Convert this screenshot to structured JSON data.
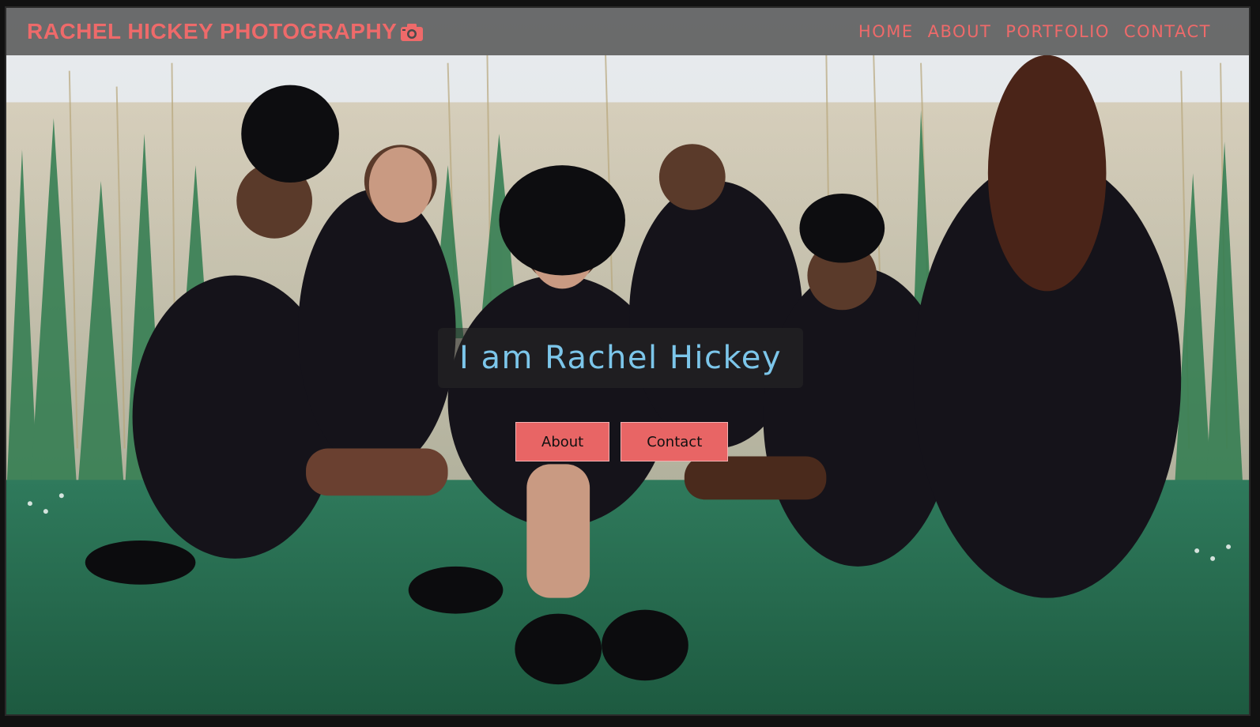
{
  "header": {
    "brand": "RACHEL HICKEY PHOTOGRAPHY",
    "brand_icon": "camera-icon",
    "nav": [
      {
        "label": "HOME"
      },
      {
        "label": "ABOUT"
      },
      {
        "label": "PORTFOLIO"
      },
      {
        "label": "CONTACT"
      }
    ]
  },
  "hero": {
    "headline": "I am Rachel Hickey",
    "buttons": {
      "about_label": "About",
      "contact_label": "Contact"
    }
  },
  "colors": {
    "accent": "#ee6a6a",
    "headline": "#7cc6ea",
    "button_bg": "#e86565",
    "navbar_bg": "#464646"
  }
}
